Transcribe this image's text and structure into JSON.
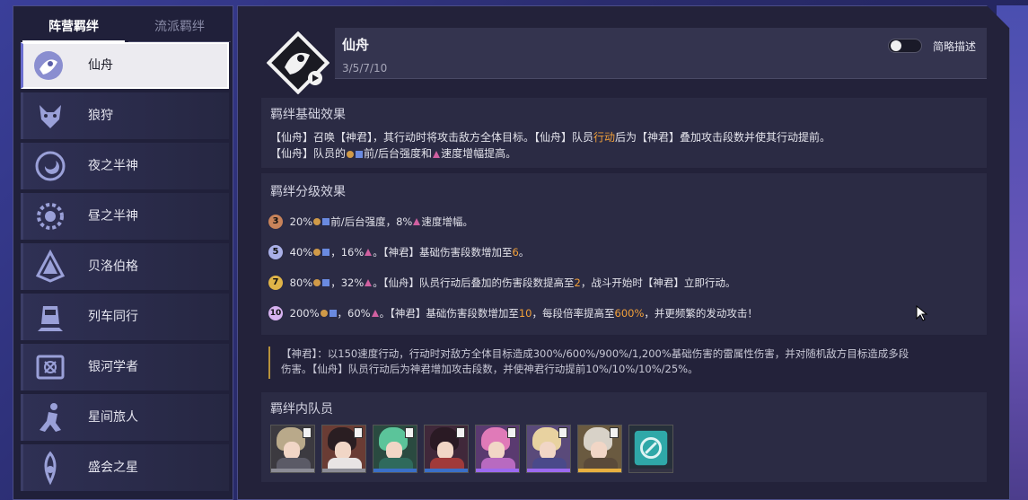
{
  "sidebar": {
    "tabs": [
      {
        "label": "阵营羁绊",
        "active": true
      },
      {
        "label": "流派羁绊",
        "active": false
      }
    ],
    "items": [
      {
        "label": "仙舟",
        "icon": "xianzhou-icon",
        "selected": true
      },
      {
        "label": "狼狩",
        "icon": "wolf-icon",
        "selected": false
      },
      {
        "label": "夜之半神",
        "icon": "moon-icon",
        "selected": false
      },
      {
        "label": "昼之半神",
        "icon": "sun-icon",
        "selected": false
      },
      {
        "label": "贝洛伯格",
        "icon": "belobog-icon",
        "selected": false
      },
      {
        "label": "列车同行",
        "icon": "train-icon",
        "selected": false
      },
      {
        "label": "银河学者",
        "icon": "book-icon",
        "selected": false
      },
      {
        "label": "星间旅人",
        "icon": "traveler-icon",
        "selected": false
      },
      {
        "label": "盛会之星",
        "icon": "star-icon",
        "selected": false
      }
    ]
  },
  "header": {
    "name": "仙舟",
    "steps": "3/5/7/10",
    "toggle_label": "简略描述",
    "toggle_on": false
  },
  "base_effect": {
    "title": "羁绊基础效果",
    "line1_a": "【仙舟】召唤【神君】，其行动时将攻击敌方全体目标。【仙舟】队员",
    "line1_hl": "行动",
    "line1_b": "后为【神君】叠加攻击段数并使其行动提前。",
    "line2_a": "【仙舟】队员的",
    "line2_b": "前/后台强度和",
    "line2_c": "速度增幅提高。"
  },
  "tier_effect": {
    "title": "羁绊分级效果",
    "tiers": [
      {
        "badge": "3",
        "color": "#c8835a",
        "a": "20%",
        "b": "前/后台强度，8%",
        "c": "速度增幅。",
        "d": "",
        "e": "",
        "f": ""
      },
      {
        "badge": "5",
        "color": "#aab0e8",
        "a": "40%",
        "b": "，16%",
        "c": "。【神君】基础伤害段数增加至",
        "d": "6",
        "e": "。",
        "f": ""
      },
      {
        "badge": "7",
        "color": "#e0b448",
        "a": "80%",
        "b": "，32%",
        "c": "。【仙舟】队员行动后叠加的伤害段数提高至",
        "d": "2",
        "e": "，战斗开始时【神君】立即行动。",
        "f": ""
      },
      {
        "badge": "10",
        "color": "#d7b2f0",
        "a": "200%",
        "b": "，60%",
        "c": "。【神君】基础伤害段数增加至",
        "d": "10",
        "e": "，每段倍率提高至",
        "f": "600%",
        "g": "，并更频繁的发动攻击！"
      }
    ]
  },
  "quote": {
    "line1": "【神君】：以150速度行动，行动时对敌方全体目标造成300%/600%/900%/1,200%基础伤害的雷属性伤害，并对随机敌方目标造成多段",
    "line2": "伤害。【仙舟】队员行动后为神君增加攻击段数，并使神君行动提前10%/10%/10%/25%。"
  },
  "members": {
    "title": "羁绊内队员",
    "list": [
      {
        "name": "member-1",
        "hair": "#b9a98a",
        "body": "#5b5a66",
        "strip": "#8c8c96",
        "bg": "#3c3a40"
      },
      {
        "name": "member-2",
        "hair": "#2a1e22",
        "body": "#e8e4e4",
        "strip": "#8c8c96",
        "bg": "#6a3c34"
      },
      {
        "name": "member-3",
        "hair": "#5bc49a",
        "body": "#2f6a5c",
        "strip": "#3a6fc8",
        "bg": "#2a4a40"
      },
      {
        "name": "member-4",
        "hair": "#2a1a24",
        "body": "#a03a3a",
        "strip": "#3a6fc8",
        "bg": "#40283a"
      },
      {
        "name": "member-5",
        "hair": "#e07ab8",
        "body": "#b86ac0",
        "strip": "#9c6af0",
        "bg": "#5a3a70"
      },
      {
        "name": "member-6",
        "hair": "#e8d2a0",
        "body": "#4a4a8a",
        "strip": "#9c6af0",
        "bg": "#5a4a7a"
      },
      {
        "name": "member-7",
        "hair": "#d8d2c8",
        "body": "#5a4a3a",
        "strip": "#e8b040",
        "bg": "#6a5a40"
      },
      {
        "name": "member-8",
        "hair": "#2fa8a8",
        "body": "#1f5a6a",
        "strip": "#333344",
        "bg": "#26303a"
      }
    ]
  },
  "colors": {
    "accent_orange": "#f2a03a",
    "panel": "#23223a",
    "section": "#2b2b44"
  }
}
